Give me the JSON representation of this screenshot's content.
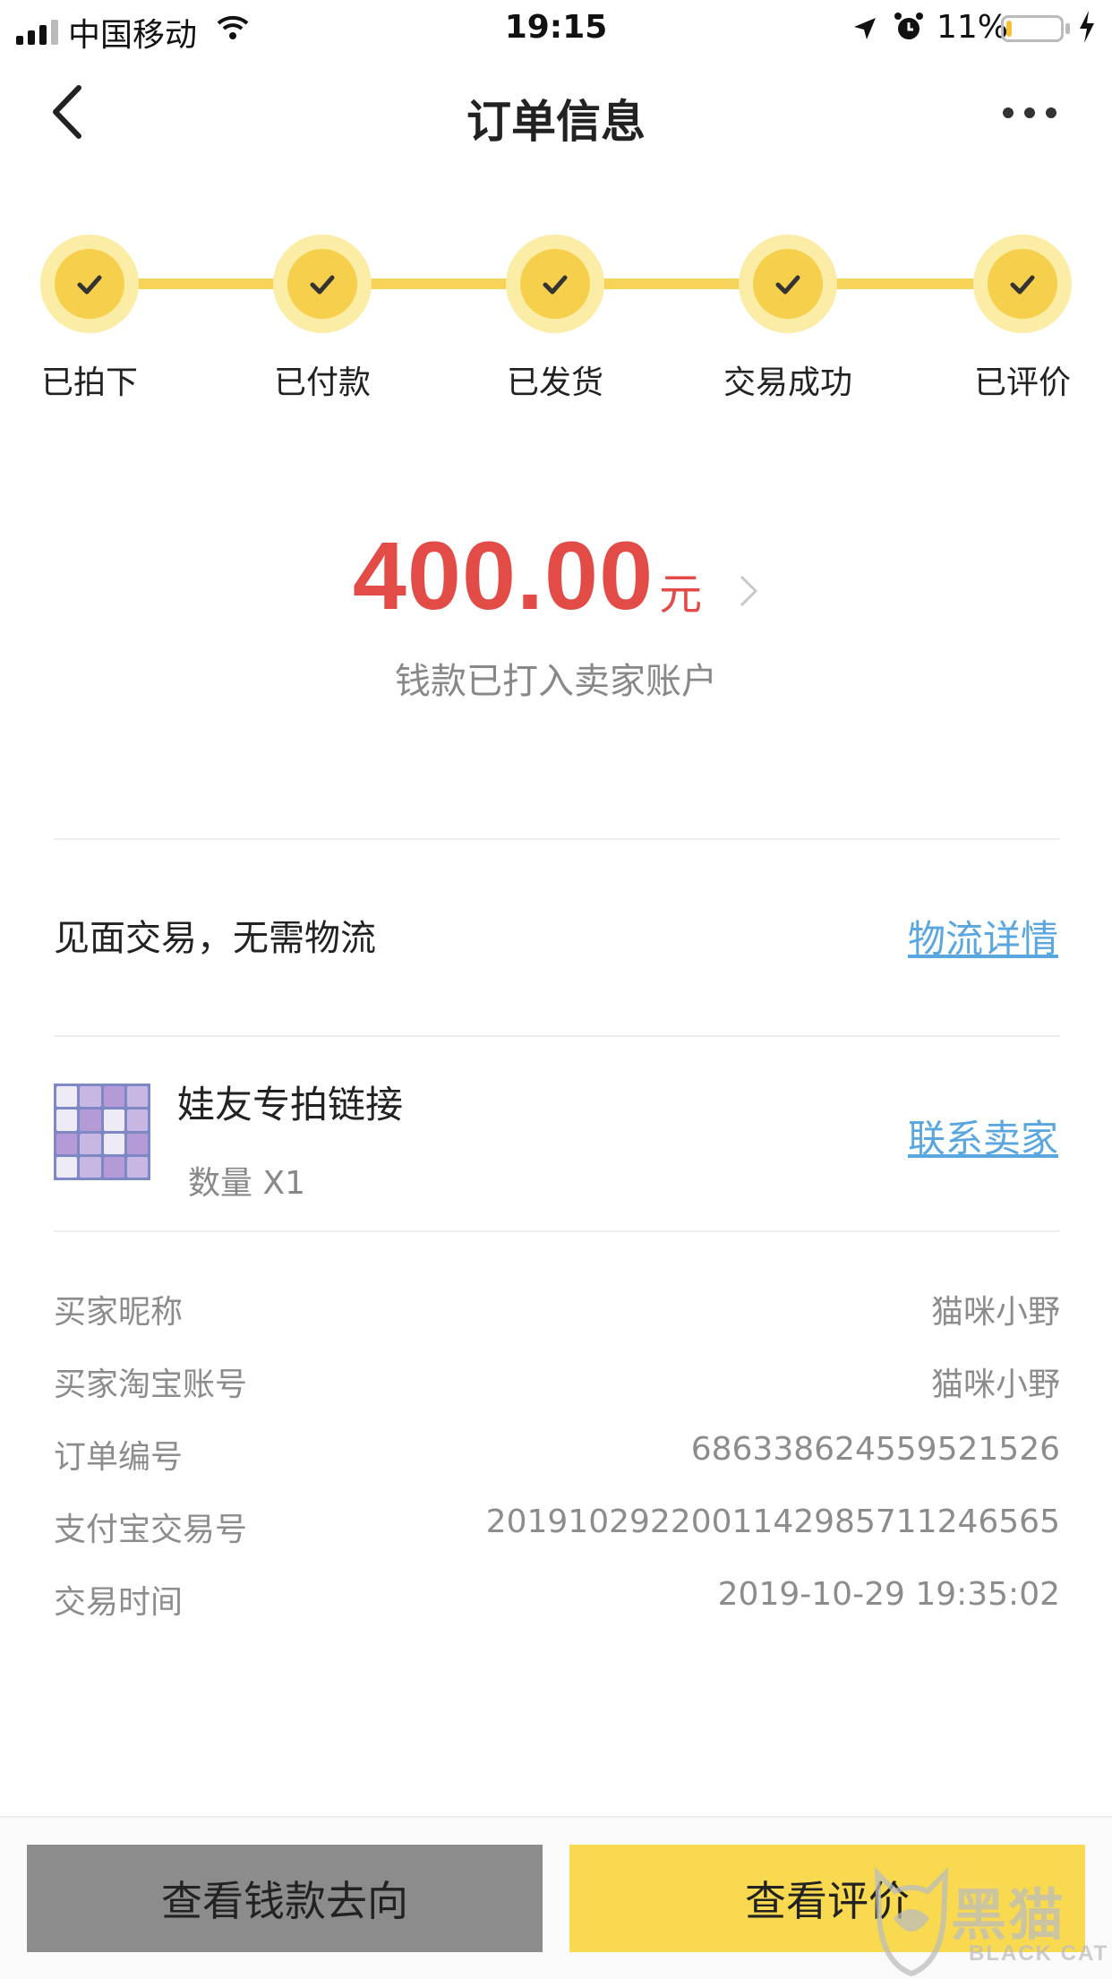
{
  "status_bar": {
    "carrier": "中国移动",
    "time": "19:15",
    "battery_percent": "11%",
    "battery_level": 0.11,
    "battery_color": "#f2c232"
  },
  "nav": {
    "title": "订单信息",
    "back_icon": "chevron-left-icon",
    "more_icon": "more-dots-icon"
  },
  "progress": {
    "accent": "#f6d04d",
    "steps": [
      {
        "label": "已拍下",
        "done": true
      },
      {
        "label": "已付款",
        "done": true
      },
      {
        "label": "已发货",
        "done": true
      },
      {
        "label": "交易成功",
        "done": true
      },
      {
        "label": "已评价",
        "done": true
      }
    ]
  },
  "amount": {
    "value": "400.00",
    "unit": "元",
    "note": "钱款已打入卖家账户",
    "color": "#e34b46"
  },
  "delivery": {
    "text": "见面交易，无需物流",
    "link_label": "物流详情"
  },
  "product": {
    "title": "娃友专拍链接",
    "quantity": "数量 X1",
    "contact_label": "联系卖家"
  },
  "info": [
    {
      "label": "买家昵称",
      "value": "猫咪小野"
    },
    {
      "label": "买家淘宝账号",
      "value": "猫咪小野"
    },
    {
      "label": "订单编号",
      "value": "686338624559521526"
    },
    {
      "label": "支付宝交易号",
      "value": "2019102922001142985711246565"
    },
    {
      "label": "交易时间",
      "value": "2019-10-29 19:35:02"
    }
  ],
  "actions": {
    "left_label": "查看钱款去向",
    "right_label": "查看评价"
  },
  "watermark": {
    "text": "黑猫",
    "sub": "BLACK CAT"
  }
}
